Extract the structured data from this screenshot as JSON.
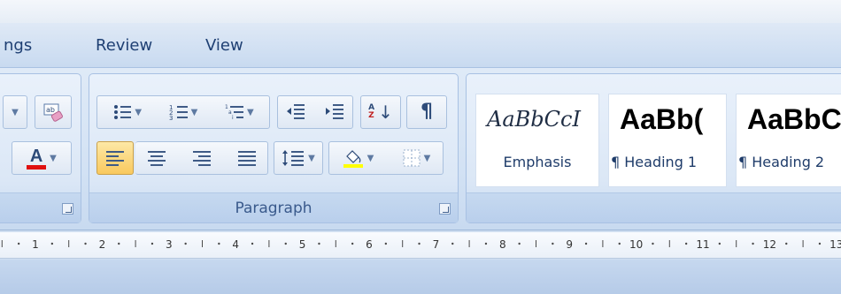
{
  "tabs": [
    "ngs",
    "Review",
    "View"
  ],
  "font_group": {
    "font_color_label": "A"
  },
  "paragraph": {
    "label": "Paragraph",
    "sort_label": "A↓",
    "pilcrow": "¶"
  },
  "styles": [
    {
      "sample": "AaBbCcI",
      "name": "Emphasis"
    },
    {
      "sample": "AaBb(",
      "name": "¶ Heading 1"
    },
    {
      "sample": "AaBbC",
      "name": "¶ Heading 2"
    }
  ],
  "ruler": {
    "numbers": [
      "1",
      "2",
      "3",
      "4",
      "5",
      "6",
      "7",
      "8",
      "9",
      "10",
      "11",
      "12",
      "13"
    ]
  },
  "colors": {
    "font_color_underline": "#e01010",
    "active_button": "#f9c95e",
    "highlight": "#ffff00"
  }
}
